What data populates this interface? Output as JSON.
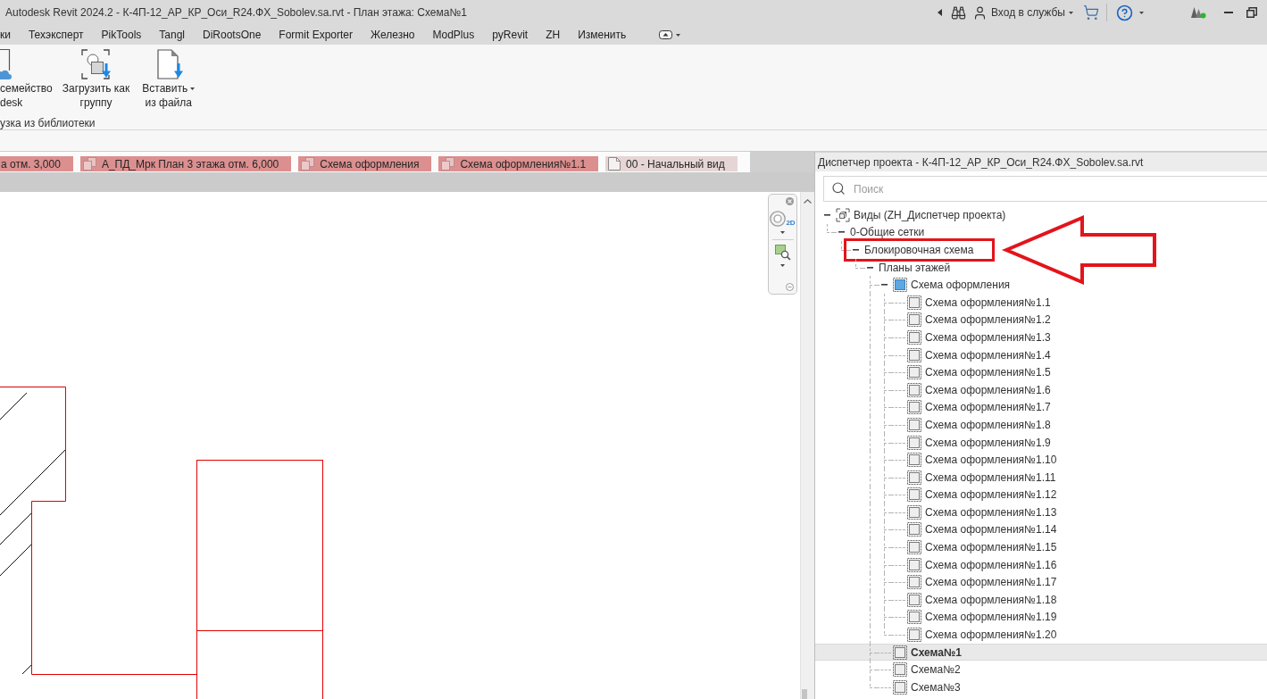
{
  "window": {
    "title": "Autodesk Revit 2024.2 - К-4П-12_АР_КР_Оси_R24.ФХ_Sobolev.sa.rvt - План этажа: Схема№1",
    "sign_in": "Вход в службы"
  },
  "ribbon_tabs": [
    {
      "label": "ки",
      "selected": false
    },
    {
      "label": "Техэксперт",
      "selected": false
    },
    {
      "label": "PikTools",
      "selected": false
    },
    {
      "label": "Tangl",
      "selected": false
    },
    {
      "label": "DiRootsOne",
      "selected": false
    },
    {
      "label": "Formit Exporter",
      "selected": false
    },
    {
      "label": "Железно",
      "selected": false
    },
    {
      "label": "ModPlus",
      "selected": false
    },
    {
      "label": "pyRevit",
      "selected": false
    },
    {
      "label": "ZH",
      "selected": false
    },
    {
      "label": "Изменить",
      "selected": false
    }
  ],
  "ribbon": {
    "buttons": [
      {
        "lines": [
          "семейство",
          "desk"
        ],
        "kind": "cloud",
        "has_menu": false
      },
      {
        "lines": [
          "Загрузить как",
          "группу"
        ],
        "kind": "group",
        "has_menu": false
      },
      {
        "lines": [
          "Вставить",
          "из файла"
        ],
        "kind": "file",
        "has_menu": true
      }
    ],
    "panel_label": "узка из библиотеки"
  },
  "view_tabs": [
    {
      "label": "а отм. 3,000",
      "kind": "plain",
      "color": "#dc8f8f",
      "selected": false
    },
    {
      "label": "А_ПД_Мрк План 3 этажа отм. 6,000",
      "kind": "sheet",
      "color": "#dc8f8f",
      "selected": false
    },
    {
      "label": "Схема оформления",
      "kind": "sheet",
      "color": "#dc8f8f",
      "selected": false
    },
    {
      "label": "Схема оформления№1.1",
      "kind": "sheet",
      "color": "#dc8f8f",
      "selected": false
    },
    {
      "label": "00 - Начальный вид",
      "kind": "page",
      "color": "#e6d5d5",
      "selected": false
    }
  ],
  "navigation_bar": {
    "wheel_label": "2D"
  },
  "project_browser": {
    "title": "Диспетчер проекта - К-4П-12_АР_КР_Оси_R24.ФХ_Sobolev.sa.rvt",
    "search": {
      "placeholder": "Поиск"
    },
    "tree": [
      {
        "label": "Виды (ZH_Диспетчер проекта)",
        "kind": "views",
        "expanded": true,
        "selected": false,
        "marked": false,
        "children": [
          {
            "label": "0-Общие сетки",
            "kind": "group",
            "expanded": true,
            "selected": false,
            "marked": false,
            "children": [
              {
                "label": "Блокировочная схема",
                "kind": "group",
                "expanded": true,
                "selected": false,
                "marked": true,
                "children": [
                  {
                    "label": "Планы этажей",
                    "kind": "group",
                    "expanded": true,
                    "selected": false,
                    "marked": false,
                    "children": [
                      {
                        "label": "Схема оформления",
                        "kind": "primary",
                        "expanded": true,
                        "selected": false,
                        "marked": false,
                        "children": [
                          {
                            "label": "Схема оформления№1.1",
                            "kind": "view",
                            "selected": false,
                            "marked": false
                          },
                          {
                            "label": "Схема оформления№1.2",
                            "kind": "view",
                            "selected": false,
                            "marked": false
                          },
                          {
                            "label": "Схема оформления№1.3",
                            "kind": "view",
                            "selected": false,
                            "marked": false
                          },
                          {
                            "label": "Схема оформления№1.4",
                            "kind": "view",
                            "selected": false,
                            "marked": false
                          },
                          {
                            "label": "Схема оформления№1.5",
                            "kind": "view",
                            "selected": false,
                            "marked": false
                          },
                          {
                            "label": "Схема оформления№1.6",
                            "kind": "view",
                            "selected": false,
                            "marked": false
                          },
                          {
                            "label": "Схема оформления№1.7",
                            "kind": "view",
                            "selected": false,
                            "marked": false
                          },
                          {
                            "label": "Схема оформления№1.8",
                            "kind": "view",
                            "selected": false,
                            "marked": false
                          },
                          {
                            "label": "Схема оформления№1.9",
                            "kind": "view",
                            "selected": false,
                            "marked": false
                          },
                          {
                            "label": "Схема оформления№1.10",
                            "kind": "view",
                            "selected": false,
                            "marked": false
                          },
                          {
                            "label": "Схема оформления№1.11",
                            "kind": "view",
                            "selected": false,
                            "marked": false
                          },
                          {
                            "label": "Схема оформления№1.12",
                            "kind": "view",
                            "selected": false,
                            "marked": false
                          },
                          {
                            "label": "Схема оформления№1.13",
                            "kind": "view",
                            "selected": false,
                            "marked": false
                          },
                          {
                            "label": "Схема оформления№1.14",
                            "kind": "view",
                            "selected": false,
                            "marked": false
                          },
                          {
                            "label": "Схема оформления№1.15",
                            "kind": "view",
                            "selected": false,
                            "marked": false
                          },
                          {
                            "label": "Схема оформления№1.16",
                            "kind": "view",
                            "selected": false,
                            "marked": false
                          },
                          {
                            "label": "Схема оформления№1.17",
                            "kind": "view",
                            "selected": false,
                            "marked": false
                          },
                          {
                            "label": "Схема оформления№1.18",
                            "kind": "view",
                            "selected": false,
                            "marked": false
                          },
                          {
                            "label": "Схема оформления№1.19",
                            "kind": "view",
                            "selected": false,
                            "marked": false
                          },
                          {
                            "label": "Схема оформления№1.20",
                            "kind": "view",
                            "selected": false,
                            "marked": false
                          }
                        ]
                      },
                      {
                        "label": "Схема№1",
                        "kind": "view",
                        "selected": true,
                        "marked": false
                      },
                      {
                        "label": "Схема№2",
                        "kind": "view",
                        "selected": false,
                        "marked": false
                      },
                      {
                        "label": "Схема№3",
                        "kind": "view",
                        "selected": false,
                        "marked": false
                      }
                    ]
                  }
                ]
              }
            ]
          }
        ]
      }
    ]
  }
}
